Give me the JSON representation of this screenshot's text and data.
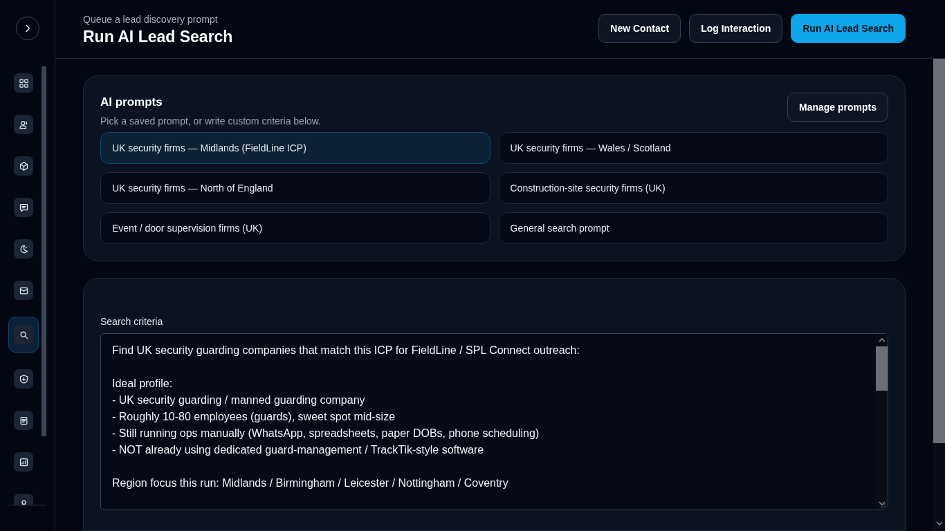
{
  "sidebar": {
    "items": [
      {
        "selected": false
      },
      {
        "selected": false
      },
      {
        "selected": false
      },
      {
        "selected": false
      },
      {
        "selected": false
      },
      {
        "selected": false
      },
      {
        "selected": true
      },
      {
        "selected": false
      },
      {
        "selected": false
      },
      {
        "selected": false
      },
      {
        "selected": false
      }
    ]
  },
  "header": {
    "subtitle": "Queue a lead discovery prompt",
    "title": "Run AI Lead Search",
    "buttons": [
      {
        "label": "New Contact",
        "kind": "secondary"
      },
      {
        "label": "Log Interaction",
        "kind": "secondary"
      },
      {
        "label": "Run AI Lead Search",
        "kind": "primary"
      }
    ]
  },
  "prompts_card": {
    "title": "AI prompts",
    "subtitle": "Pick a saved prompt, or write custom criteria below.",
    "manage_button": "Manage prompts",
    "prompts": [
      {
        "label": "UK security firms — Midlands (FieldLine ICP)",
        "selected": true
      },
      {
        "label": "UK security firms — Wales / Scotland",
        "selected": false
      },
      {
        "label": "UK security firms — North of England",
        "selected": false
      },
      {
        "label": "Construction-site security firms (UK)",
        "selected": false
      },
      {
        "label": "Event / door supervision firms (UK)",
        "selected": false
      },
      {
        "label": "General search prompt",
        "selected": false
      }
    ]
  },
  "criteria_card": {
    "label": "Search criteria",
    "value": "Find UK security guarding companies that match this ICP for FieldLine / SPL Connect outreach:\n\nIdeal profile:\n- UK security guarding / manned guarding company\n- Roughly 10-80 employees (guards), sweet spot mid-size\n- Still running ops manually (WhatsApp, spreadsheets, paper DOBs, phone scheduling)\n- NOT already using dedicated guard-management / TrackTik-style software\n\nRegion focus this run: Midlands / Birmingham / Leicester / Nottingham / Coventry"
  }
}
